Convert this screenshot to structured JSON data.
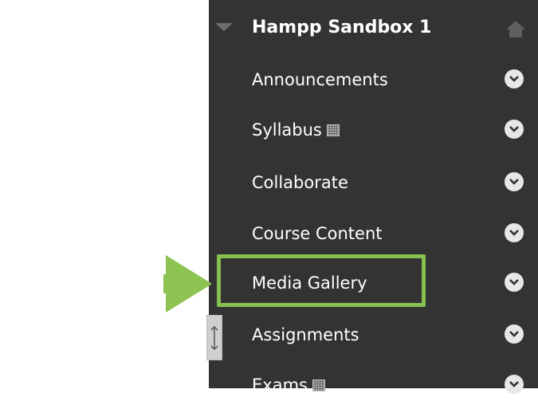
{
  "course": {
    "title": "Hampp Sandbox 1"
  },
  "menu": {
    "items": [
      {
        "label": "Announcements",
        "has_mark": false
      },
      {
        "label": "Syllabus",
        "has_mark": true
      },
      {
        "label": "Collaborate",
        "has_mark": false
      },
      {
        "label": "Course Content",
        "has_mark": false
      },
      {
        "label": "Media Gallery",
        "has_mark": false,
        "highlighted": true
      },
      {
        "label": "Assignments",
        "has_mark": false
      },
      {
        "label": "Exams",
        "has_mark": true
      }
    ]
  },
  "colors": {
    "menu_background": "#333333",
    "highlight": "#86c04e",
    "arrow": "#8dc451",
    "chevron": "#e7e7e7"
  }
}
